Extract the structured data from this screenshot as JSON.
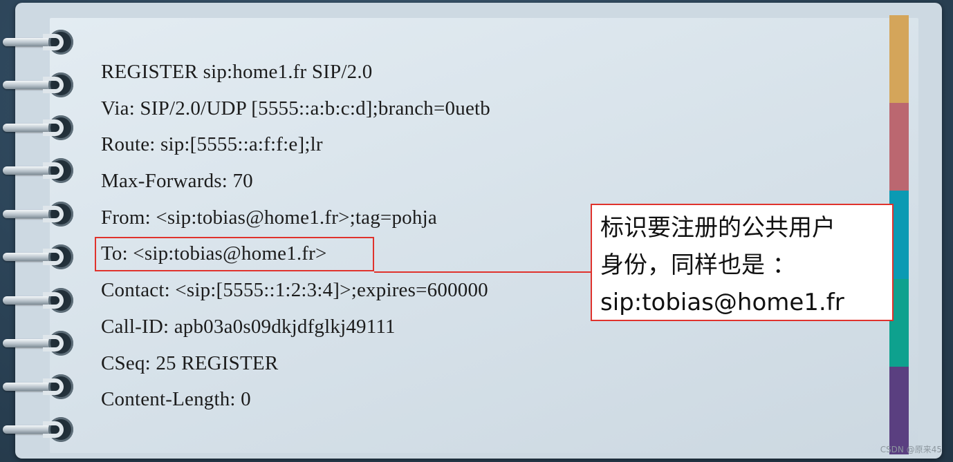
{
  "sip_message": {
    "lines": [
      "REGISTER sip:home1.fr SIP/2.0",
      "Via: SIP/2.0/UDP [5555::a:b:c:d];branch=0uetb",
      "Route: sip:[5555::a:f:f:e];lr",
      "Max-Forwards: 70",
      "From: <sip:tobias@home1.fr>;tag=pohja",
      "To: <sip:tobias@home1.fr>",
      "Contact: <sip:[5555::1:2:3:4]>;expires=600000",
      "Call-ID: apb03a0s09dkjdfglkj49111",
      "CSeq: 25 REGISTER",
      "Content-Length: 0"
    ],
    "highlighted_line_index": 5
  },
  "callout": {
    "line1": "标识要注册的公共用户",
    "line2": "身份，同样也是 ：",
    "line3": "sip:tobias@home1.fr"
  },
  "tabs": {
    "colors": [
      "#d4a55a",
      "#bb6770",
      "#0b9ab3",
      "#0ea18e",
      "#5a3f80"
    ]
  },
  "watermark": "CSDN @原来45",
  "colors": {
    "highlight": "#e0322c",
    "background": "#2c4458"
  }
}
